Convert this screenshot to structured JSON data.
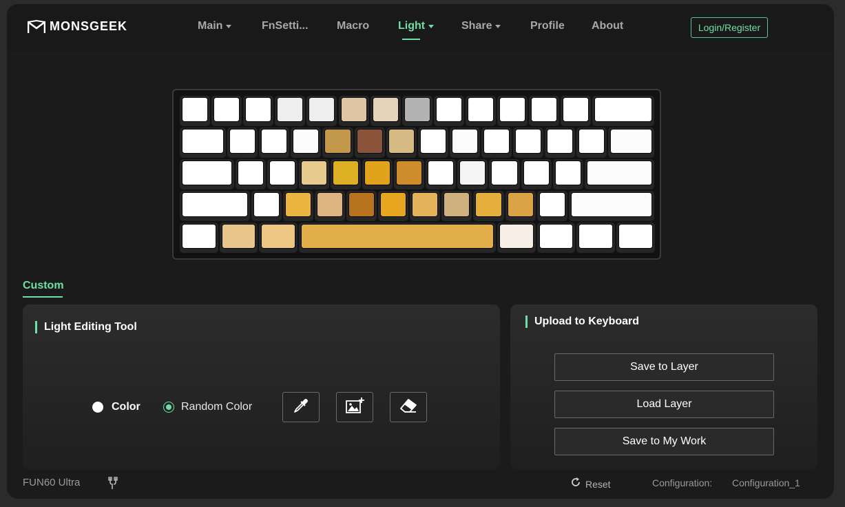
{
  "header": {
    "logo_text": "MONSGEEK",
    "nav": [
      {
        "label": "Main",
        "dropdown": true,
        "active": false
      },
      {
        "label": "FnSetti...",
        "dropdown": false,
        "active": false
      },
      {
        "label": "Macro",
        "dropdown": false,
        "active": false
      },
      {
        "label": "Light",
        "dropdown": true,
        "active": true
      },
      {
        "label": "Share",
        "dropdown": true,
        "active": false
      },
      {
        "label": "Profile",
        "dropdown": false,
        "active": false
      },
      {
        "label": "About",
        "dropdown": false,
        "active": false
      }
    ],
    "login_label": "Login/Register"
  },
  "colors": {
    "accent": "#6ee0a7",
    "background": "#1b1b1b",
    "panel": "#262626"
  },
  "keyboard": {
    "rows": [
      [
        "#ffffff",
        "#ffffff",
        "#ffffff",
        "#eeeeee",
        "#eeeeee",
        "#dfc5a3",
        "#e5d3bb",
        "#b3b3b3",
        "#ffffff",
        "#ffffff",
        "#ffffff",
        "#ffffff",
        "#ffffff",
        "#ffffff"
      ],
      [
        "#ffffff",
        "#ffffff",
        "#ffffff",
        "#fbfbfb",
        "#c2994a",
        "#8a543a",
        "#d6ba84",
        "#ffffff",
        "#fbfbfb",
        "#ffffff",
        "#ffffff",
        "#ffffff",
        "#ffffff",
        "#fbfbfb"
      ],
      [
        "#ffffff",
        "#ffffff",
        "#ffffff",
        "#e8c98e",
        "#deb124",
        "#e2a31c",
        "#cf8c2a",
        "#ffffff",
        "#f5f5f5",
        "#ffffff",
        "#ffffff",
        "#ffffff",
        "#fbfbfb"
      ],
      [
        "#ffffff",
        "#ffffff",
        "#ebb63f",
        "#dcb480",
        "#b8731e",
        "#e6a61f",
        "#e3b259",
        "#cfb07f",
        "#e5af3d",
        "#d9a346",
        "#ffffff",
        "#fbfbfb"
      ],
      [
        "#ffffff",
        "#e8c58a",
        "#ecc682",
        "#e2af4a",
        "#f7efe5",
        "#ffffff",
        "#ffffff",
        "#ffffff"
      ]
    ]
  },
  "custom_tab_label": "Custom",
  "light_panel": {
    "title": "Light Editing Tool",
    "color_option": "Color",
    "random_option": "Random Color",
    "tools": [
      "eyedropper-icon",
      "add-image-icon",
      "eraser-icon"
    ]
  },
  "upload_panel": {
    "title": "Upload to Keyboard",
    "buttons": [
      "Save to Layer",
      "Load Layer",
      "Save to My Work"
    ]
  },
  "footer": {
    "device": "FUN60 Ultra",
    "reset_label": "Reset",
    "config_label": "Configuration:",
    "config_value": "Configuration_1"
  }
}
